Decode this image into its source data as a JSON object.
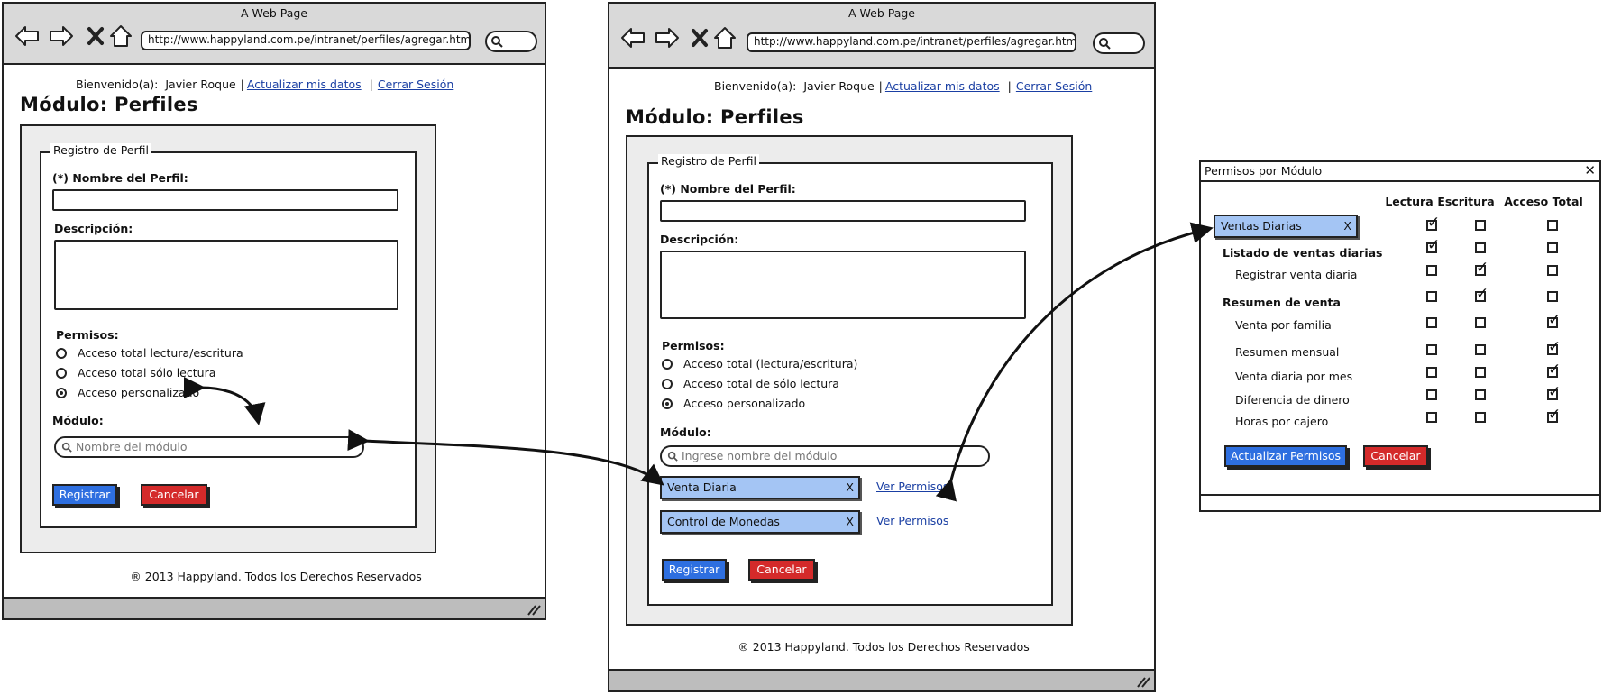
{
  "browser": {
    "title": "A Web Page",
    "url": "http://www.happyland.com.pe/intranet/perfiles/agregar.html"
  },
  "header": {
    "welcome_prefix": "Bienvenido(a):",
    "user_name": "Javier Roque",
    "update_link": "Actualizar mis datos",
    "logout_link": "Cerrar Sesión",
    "separator": "|"
  },
  "page_title": "Módulo: Perfiles",
  "form": {
    "legend": "Registro de Perfil",
    "name_label": "(*) Nombre del Perfil:",
    "description_label": "Descripción:",
    "permissions_label": "Permisos:",
    "module_label": "Módulo:",
    "register_button": "Registrar",
    "cancel_button": "Cancelar"
  },
  "mockup_left": {
    "radio_options": [
      "Acceso total lectura/escritura",
      "Acceso total sólo lectura",
      "Acceso personalizado"
    ],
    "selected_radio": 2,
    "module_placeholder": "Nombre del módulo"
  },
  "mockup_right": {
    "radio_options": [
      "Acceso total (lectura/escritura)",
      "Acceso total de sólo lectura",
      "Acceso personalizado"
    ],
    "selected_radio": 2,
    "module_placeholder": "Ingrese nombre del módulo",
    "modules": [
      {
        "name": "Venta Diaria",
        "remove": "X",
        "link": "Ver Permisos"
      },
      {
        "name": "Control de Monedas",
        "remove": "X",
        "link": "Ver Permisos"
      }
    ]
  },
  "footer": "® 2013 Happyland. Todos los Derechos Reservados",
  "dialog": {
    "title": "Permisos por Módulo",
    "close": "✕",
    "columns": [
      "Lectura",
      "Escritura",
      "Acceso Total"
    ],
    "module_tag": "Ventas Diarias",
    "module_tag_remove": "X",
    "rows": [
      {
        "label": "Ventas Diarias",
        "lectura": true,
        "escritura": false,
        "total": false
      },
      {
        "label": "Listado de ventas diarias",
        "lectura": true,
        "escritura": false,
        "total": false
      },
      {
        "label": "Registrar venta diaria",
        "lectura": false,
        "escritura": true,
        "total": false
      },
      {
        "label": "Resumen de venta",
        "lectura": false,
        "escritura": true,
        "total": false
      },
      {
        "label": "Venta por familia",
        "lectura": false,
        "escritura": false,
        "total": true
      },
      {
        "label": "Resumen mensual",
        "lectura": false,
        "escritura": false,
        "total": true
      },
      {
        "label": "Venta diaria por mes",
        "lectura": false,
        "escritura": false,
        "total": true
      },
      {
        "label": "Diferencia de dinero",
        "lectura": false,
        "escritura": false,
        "total": true
      },
      {
        "label": "Horas por cajero",
        "lectura": false,
        "escritura": false,
        "total": true
      }
    ],
    "update_button": "Actualizar Permisos",
    "cancel_button": "Cancelar"
  },
  "colors": {
    "primary_button": "#2e6fe0",
    "danger_button": "#d42a2a",
    "tag_fill": "#a4c5f4",
    "chrome": "#d9d9d9",
    "link": "#1a3fa3"
  }
}
